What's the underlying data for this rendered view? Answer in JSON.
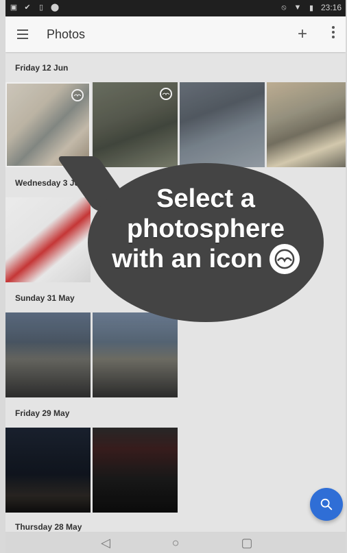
{
  "status_bar": {
    "time": "23:16",
    "icons_left": [
      "image-icon",
      "check-icon",
      "phone-icon",
      "pin-icon"
    ],
    "icons_right": [
      "do-not-disturb-icon",
      "wifi-icon",
      "battery-icon"
    ]
  },
  "app_bar": {
    "title": "Photos"
  },
  "sections": [
    {
      "date": "Friday 12 Jun"
    },
    {
      "date": "Wednesday 3 Jun"
    },
    {
      "date": "Sunday 31 May"
    },
    {
      "date": "Friday 29 May"
    },
    {
      "date": "Thursday 28 May"
    }
  ],
  "overlay": {
    "line1": "Select a",
    "line2": "photosphere",
    "line3": "with an icon"
  },
  "colors": {
    "fab": "#2f6ed6",
    "bubble": "#444444"
  }
}
